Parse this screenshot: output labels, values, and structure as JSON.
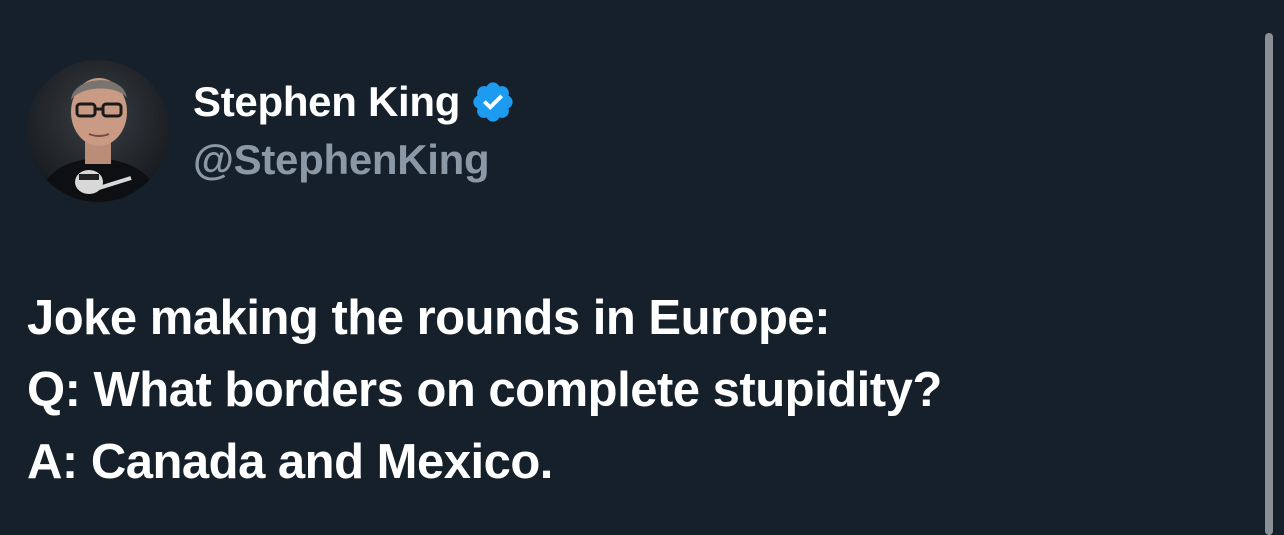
{
  "author": {
    "display_name": "Stephen King",
    "handle": "@StephenKing",
    "verified_icon": "verified-badge-icon",
    "avatar_icon": "profile-photo"
  },
  "tweet": {
    "lines": [
      "Joke making the rounds in Europe:",
      "Q: What borders on complete stupidity?",
      "A: Canada and Mexico."
    ]
  },
  "colors": {
    "background": "#16202b",
    "text_primary": "#ffffff",
    "text_secondary": "#8b98a5",
    "verified_blue": "#1d9bf0"
  }
}
